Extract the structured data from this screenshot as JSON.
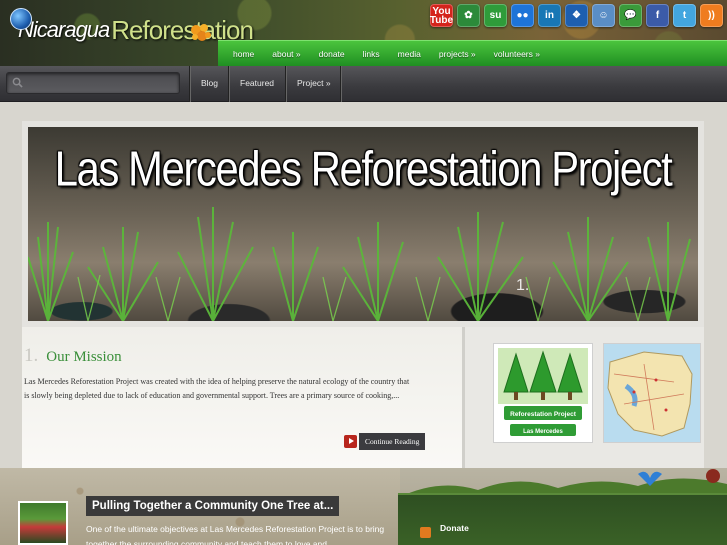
{
  "header": {
    "logo_word1": "Nicaragua",
    "logo_word2": "Reforestation"
  },
  "social": [
    {
      "name": "youtube-icon",
      "label": "You\nTube",
      "color": "#d4241c"
    },
    {
      "name": "treehugger-icon",
      "label": "✿",
      "color": "#2c8a3a"
    },
    {
      "name": "stumbleupon-icon",
      "label": "su",
      "color": "#2f9c3a"
    },
    {
      "name": "flickr-icon",
      "label": "●●",
      "color": "#1d74d8"
    },
    {
      "name": "linkedin-icon",
      "label": "in",
      "color": "#1877b5"
    },
    {
      "name": "myspace-icon",
      "label": "❖",
      "color": "#1d5fb0"
    },
    {
      "name": "reddit-icon",
      "label": "☺",
      "color": "#5a8ec6"
    },
    {
      "name": "chat-icon",
      "label": "💬",
      "color": "#3a9a3a"
    },
    {
      "name": "facebook-icon",
      "label": "f",
      "color": "#3b5ba8"
    },
    {
      "name": "twitter-icon",
      "label": "t",
      "color": "#43a6df"
    },
    {
      "name": "rss-icon",
      "label": "))",
      "color": "#ef7c1f"
    }
  ],
  "topnav": [
    "home",
    "about »",
    "donate",
    "links",
    "media",
    "projects »",
    "volunteers »"
  ],
  "search": {
    "placeholder": ""
  },
  "subnav": {
    "blog": "Blog",
    "featured": "Featured",
    "project": "Project »"
  },
  "slider": {
    "title": "Las Mercedes Reforestation Project",
    "slide_number": "1."
  },
  "mission": {
    "number": "1.",
    "title": "Our Mission",
    "text": "Las Mercedes Reforestation Project was created with the idea of helping preserve the natural ecology of the country that is slowly being depleted due to lack of education and governmental support.  Trees are a primary source of cooking,...",
    "continue_label": "Continue Reading"
  },
  "badge": {
    "line1": "Reforestation Project",
    "line2": "Las Mercedes"
  },
  "post": {
    "title": "Pulling Together a Community One Tree at...",
    "excerpt": "One of the ultimate objectives at Las Mercedes Reforestation Project is to bring together the surrounding community and teach them to love and"
  },
  "panel": {
    "donate": "Donate"
  },
  "colors": {
    "nav_green": "#2fa52c",
    "accent_green": "#3a8f3a",
    "dark_bar": "#3b3b3f"
  }
}
